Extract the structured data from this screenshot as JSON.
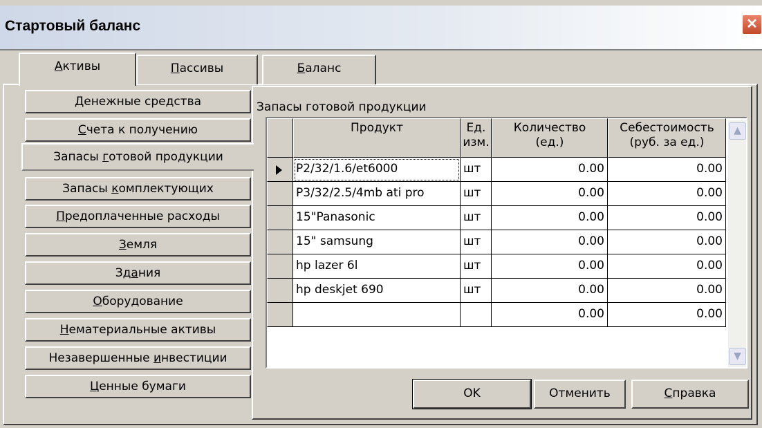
{
  "window": {
    "title": "Стартовый баланс",
    "close_glyph": "✕"
  },
  "tabs": [
    {
      "pre": "",
      "key": "А",
      "post": "ктивы",
      "active": true
    },
    {
      "pre": "",
      "key": "П",
      "post": "ассивы",
      "active": false
    },
    {
      "pre": "",
      "key": "Б",
      "post": "аланс",
      "active": false
    }
  ],
  "categories": [
    {
      "pre": "",
      "key": "Д",
      "post": "енежные средства"
    },
    {
      "pre": "",
      "key": "С",
      "post": "чета к получению"
    },
    {
      "pre": "Запасы ",
      "key": "г",
      "post": "отовой продукции",
      "active": true
    },
    {
      "pre": "Запасы ",
      "key": "к",
      "post": "омплектующих"
    },
    {
      "pre": "",
      "key": "П",
      "post": "редоплаченные расходы"
    },
    {
      "pre": "",
      "key": "З",
      "post": "емля"
    },
    {
      "pre": "Зд",
      "key": "а",
      "post": "ния"
    },
    {
      "pre": "",
      "key": "О",
      "post": "борудование"
    },
    {
      "pre": "",
      "key": "Н",
      "post": "ематериальные активы"
    },
    {
      "pre": "Незавершенные ",
      "key": "и",
      "post": "нвестиции"
    },
    {
      "pre": "",
      "key": "Ц",
      "post": "енные бумаги"
    }
  ],
  "panel": {
    "caption": "Запасы готовой продукции"
  },
  "grid": {
    "headers": {
      "product": "Продукт",
      "unit_1": "Ед.",
      "unit_2": "изм.",
      "qty_1": "Количество",
      "qty_2": "(ед.)",
      "cost_1": "Себестоимость",
      "cost_2": "(руб. за ед.)"
    },
    "rows": [
      {
        "product": "P2/32/1.6/et6000",
        "unit": "шт",
        "qty": "0.00",
        "cost": "0.00",
        "current": true
      },
      {
        "product": "P3/32/2.5/4mb ati pro",
        "unit": "шт",
        "qty": "0.00",
        "cost": "0.00"
      },
      {
        "product": "15\"Panasonic",
        "unit": "шт",
        "qty": "0.00",
        "cost": "0.00"
      },
      {
        "product": "15\" samsung",
        "unit": "шт",
        "qty": "0.00",
        "cost": "0.00"
      },
      {
        "product": "hp lazer 6l",
        "unit": "шт",
        "qty": "0.00",
        "cost": "0.00"
      },
      {
        "product": "hp deskjet 690",
        "unit": "шт",
        "qty": "0.00",
        "cost": "0.00"
      },
      {
        "product": "",
        "unit": "",
        "qty": "0.00",
        "cost": "0.00"
      }
    ],
    "scroll_up_glyph": "▲",
    "scroll_down_glyph": "▼"
  },
  "buttons": {
    "ok": "OK",
    "cancel": "Отменить",
    "help_key": "С",
    "help_rest": "правка"
  },
  "colors": {
    "face": "#d4d0c8",
    "close": "#c24a2c"
  }
}
